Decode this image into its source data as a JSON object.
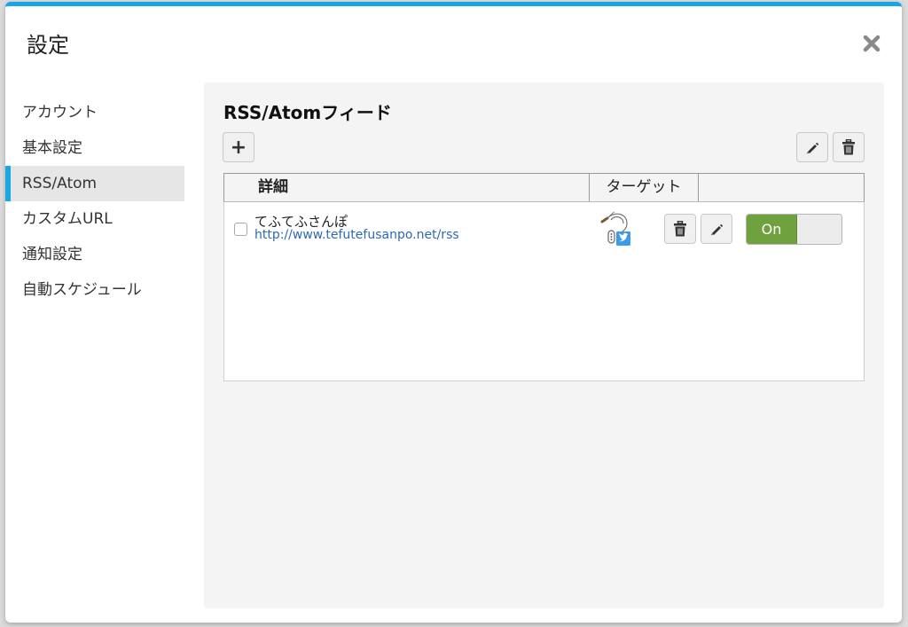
{
  "dialog": {
    "title": "設定",
    "close_icon": "close-icon"
  },
  "sidebar": {
    "items": [
      {
        "label": "アカウント",
        "active": false
      },
      {
        "label": "基本設定",
        "active": false
      },
      {
        "label": "RSS/Atom",
        "active": true
      },
      {
        "label": "カスタムURL",
        "active": false
      },
      {
        "label": "通知設定",
        "active": false
      },
      {
        "label": "自動スケジュール",
        "active": false
      }
    ]
  },
  "panel": {
    "title": "RSS/Atomフィード",
    "add_label": "+",
    "edit_icon": "pencil-icon",
    "delete_icon": "trash-icon",
    "table": {
      "headers": [
        "詳細",
        "ターゲット",
        ""
      ],
      "rows": [
        {
          "checked": false,
          "name": "てふてふさんぽ",
          "url": "http://www.tefutefusanpo.net/rss",
          "target_icon": "twitter-target-icon",
          "toggle_label": "On",
          "enabled": true
        }
      ]
    }
  },
  "colors": {
    "accent": "#1aa6e4",
    "toggle_on": "#6fa13f",
    "link": "#2e6ab0"
  }
}
